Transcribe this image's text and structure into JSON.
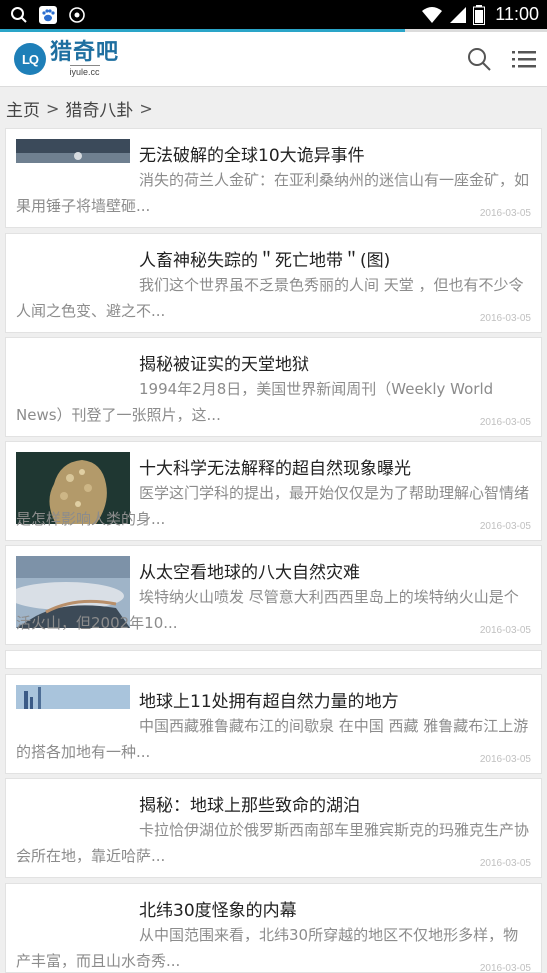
{
  "status_bar": {
    "time": "11:00"
  },
  "header": {
    "logo_name": "猎奇吧",
    "logo_domain": "iyule.cc",
    "logo_mark": "LQ"
  },
  "breadcrumb": {
    "home": "主页",
    "sep1": ">",
    "section": "猎奇八卦",
    "sep2": ">"
  },
  "articles": [
    {
      "title": "无法破解的全球10大诡异事件",
      "desc": "消失的荷兰人金矿：在亚利桑纳州的迷信山有一座金矿，如果用锤子将墙壁砸...",
      "date": "2016-03-05"
    },
    {
      "title": "人畜神秘失踪的＂死亡地带＂(图)",
      "desc": "我们这个世界虽不乏景色秀丽的人间 天堂 ，但也有不少令人闻之色变、避之不...",
      "date": "2016-03-05"
    },
    {
      "title": "揭秘被证实的天堂地狱",
      "desc": "1994年2月8日，美国世界新闻周刊（Weekly World News）刊登了一张照片，这...",
      "date": "2016-03-05"
    },
    {
      "title": "十大科学无法解释的超自然现象曝光",
      "desc": "医学这门学科的提出，最开始仅仅是为了帮助理解心智情绪是怎样影响人类的身...",
      "date": "2016-03-05"
    },
    {
      "title": "从太空看地球的八大自然灾难",
      "desc": "埃特纳火山喷发 尽管意大利西西里岛上的埃特纳火山是个活火山，但2002年10...",
      "date": "2016-03-05"
    },
    {
      "title": "地球上11处拥有超自然力量的地方",
      "desc": "中国西藏雅鲁藏布江的间歇泉 在中国 西藏 雅鲁藏布江上游的搭各加地有一种...",
      "date": "2016-03-05"
    },
    {
      "title": "揭秘：地球上那些致命的湖泊",
      "desc": "卡拉恰伊湖位於俄罗斯西南部车里雅宾斯克的玛雅克生产协会所在地，靠近哈萨...",
      "date": "2016-03-05"
    },
    {
      "title": "北纬30度怪象的内幕",
      "desc": "从中国范围来看，北纬30所穿越的地区不仅地形多样，物产丰富，而且山水奇秀...",
      "date": "2016-03-05"
    }
  ],
  "page_load_progress": 0.74
}
